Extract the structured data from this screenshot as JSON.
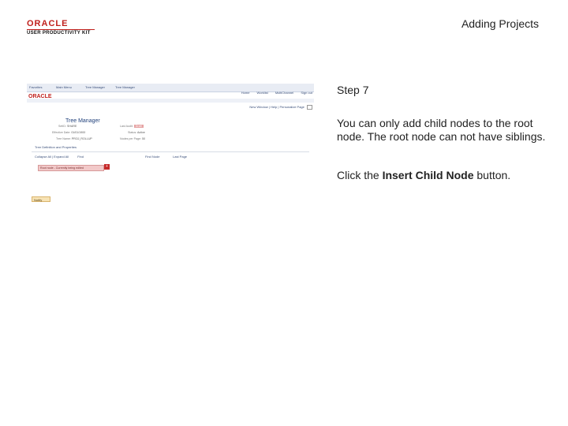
{
  "header": {
    "logo_mark": "ORACLE",
    "logo_subtitle": "USER PRODUCTIVITY KIT",
    "title": "Adding Projects"
  },
  "screenshot": {
    "navbar": [
      "Favorites",
      "Main Menu",
      "Tree Manager",
      "Tree Manager"
    ],
    "oracle_text": "ORACLE",
    "top_links": [
      "Home",
      "Worklist",
      "MultiChannel",
      "Sign out"
    ],
    "new_window_links": [
      "New Window",
      "Help",
      "Personalize Page"
    ],
    "title": "Tree Manager",
    "fields": [
      {
        "label": "SetID:",
        "value": "SHARE"
      },
      {
        "label": "Effective Date:",
        "value": "01/01/1900"
      },
      {
        "label": "Tree Name:",
        "value": "PROJ_ROLLUP"
      },
      {
        "label": "Last Audit:",
        "value": "Draft"
      },
      {
        "label": "Status:",
        "value": "Active"
      },
      {
        "label": "Nodes per Page:",
        "value": "50"
      }
    ],
    "row_links": "Tree Definition and Properties",
    "collapse_find_row": [
      "Collapse All",
      "Expand All",
      "Find",
      "Find Node",
      "Last Page"
    ],
    "node_text": "Root node - Currently being edited",
    "insert_button_glyph": "+",
    "notify_label": "Notify"
  },
  "instructions": {
    "step": "Step 7",
    "paragraph1": "You can only add child nodes to the root node. The root node can not have siblings.",
    "click_prefix": "Click the ",
    "click_target": "Insert Child Node",
    "click_suffix": " button."
  }
}
